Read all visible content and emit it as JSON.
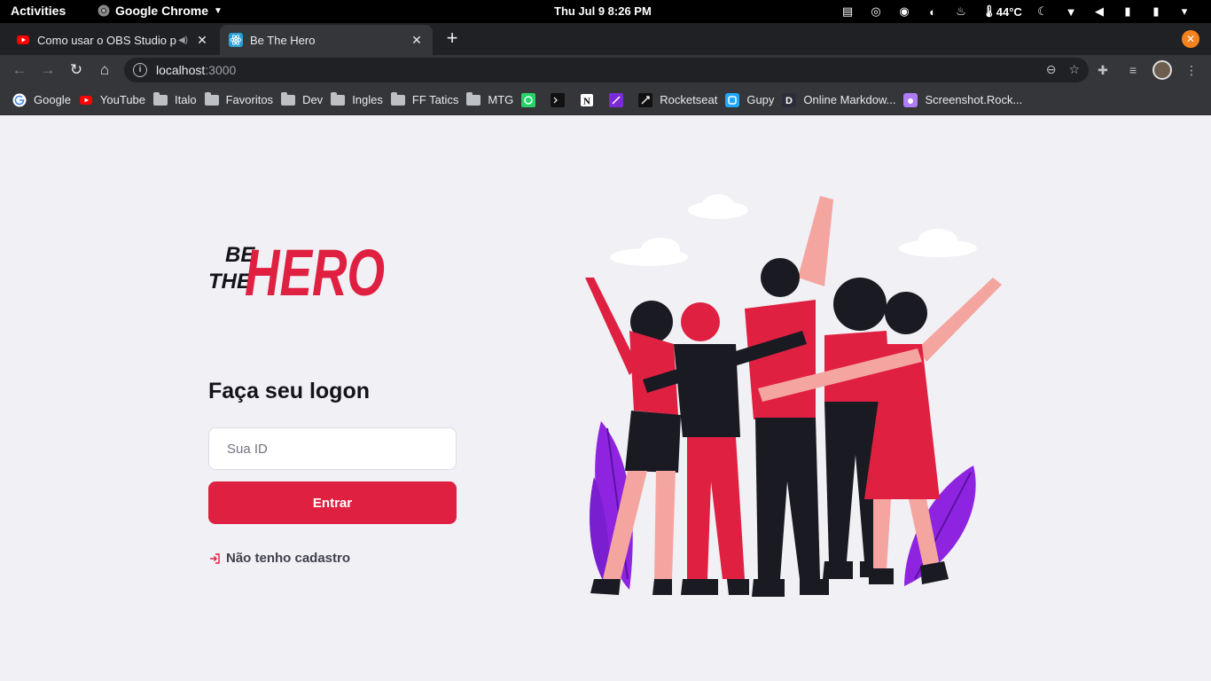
{
  "system_bar": {
    "activities": "Activities",
    "app_name": "Google Chrome",
    "clock": "Thu Jul 9   8:26 PM",
    "temperature": "44°C"
  },
  "tabs": [
    {
      "title": "Como usar o OBS Studio p",
      "icon": "youtube-icon",
      "active": false
    },
    {
      "title": "Be The Hero",
      "icon": "react-icon",
      "active": true
    }
  ],
  "toolbar": {
    "url_host": "localhost",
    "url_port": ":3000"
  },
  "bookmarks": [
    {
      "label": "Google",
      "icon": "google-icon"
    },
    {
      "label": "YouTube",
      "icon": "youtube-icon"
    },
    {
      "label": "Italo",
      "icon": "folder-icon"
    },
    {
      "label": "Favoritos",
      "icon": "folder-icon"
    },
    {
      "label": "Dev",
      "icon": "folder-icon"
    },
    {
      "label": "Ingles",
      "icon": "folder-icon"
    },
    {
      "label": "FF Tatics",
      "icon": "folder-icon"
    },
    {
      "label": "MTG",
      "icon": "folder-icon"
    },
    {
      "label": "",
      "icon": "whatsapp-icon"
    },
    {
      "label": "",
      "icon": "terminal-icon"
    },
    {
      "label": "",
      "icon": "notion-icon"
    },
    {
      "label": "",
      "icon": "figma-like-icon"
    },
    {
      "label": "Rocketseat",
      "icon": "rocketseat-icon"
    },
    {
      "label": "Gupy",
      "icon": "gupy-icon"
    },
    {
      "label": "Online Markdow...",
      "icon": "markdown-icon"
    },
    {
      "label": "Screenshot.Rock...",
      "icon": "screenshot-icon"
    }
  ],
  "login": {
    "logo_be": "BE",
    "logo_the": "THE",
    "logo_hero": "HERO",
    "title": "Faça seu logon",
    "id_placeholder": "Sua ID",
    "id_value": "",
    "submit_label": "Entrar",
    "register_label": "Não tenho cadastro"
  },
  "colors": {
    "accent": "#e02041",
    "background": "#f0f0f5",
    "text_dark": "#13131a"
  }
}
